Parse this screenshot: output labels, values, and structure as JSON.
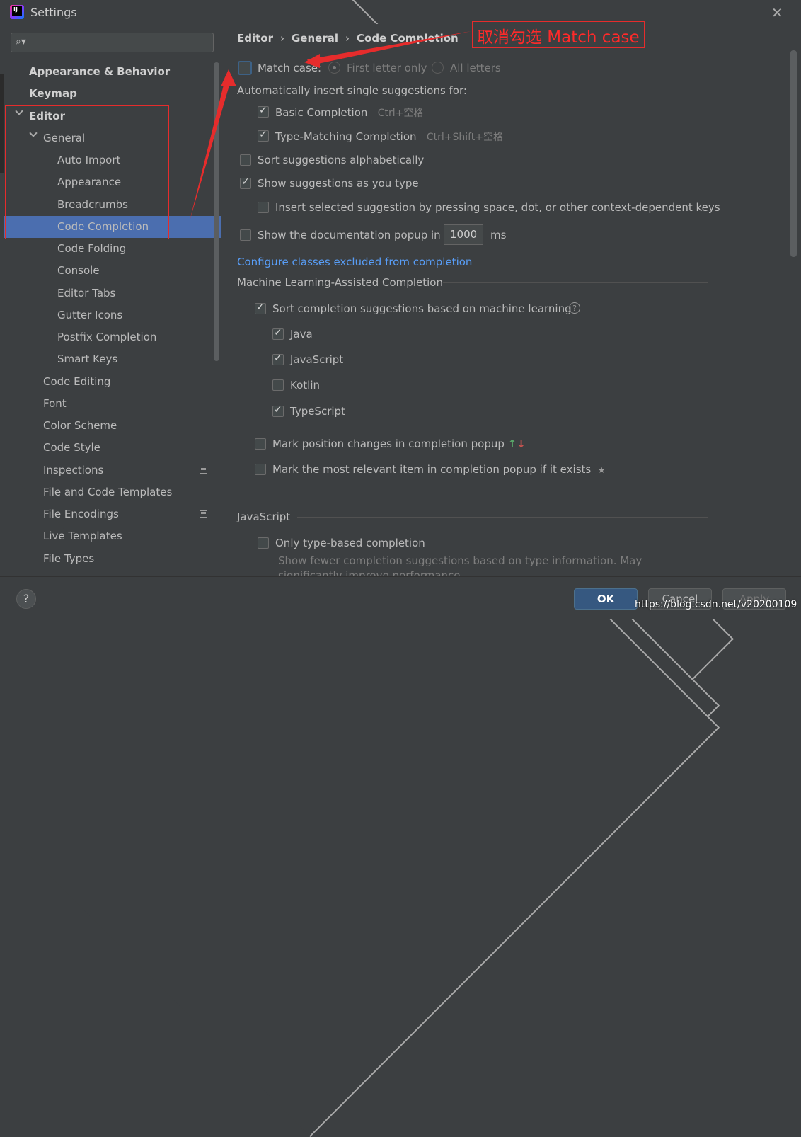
{
  "window": {
    "title": "Settings"
  },
  "tree": [
    {
      "label": "Appearance & Behavior",
      "level": 0,
      "expander": "right",
      "bold": true
    },
    {
      "label": "Keymap",
      "level": 0,
      "expander": "none",
      "bold": true
    },
    {
      "label": "Editor",
      "level": 0,
      "expander": "down",
      "bold": true
    },
    {
      "label": "General",
      "level": 1,
      "expander": "down",
      "bold": false
    },
    {
      "label": "Auto Import",
      "level": 2,
      "expander": "none",
      "bold": false
    },
    {
      "label": "Appearance",
      "level": 2,
      "expander": "none",
      "bold": false
    },
    {
      "label": "Breadcrumbs",
      "level": 2,
      "expander": "none",
      "bold": false
    },
    {
      "label": "Code Completion",
      "level": 2,
      "expander": "none",
      "bold": false,
      "selected": true
    },
    {
      "label": "Code Folding",
      "level": 2,
      "expander": "none",
      "bold": false
    },
    {
      "label": "Console",
      "level": 2,
      "expander": "none",
      "bold": false
    },
    {
      "label": "Editor Tabs",
      "level": 2,
      "expander": "none",
      "bold": false
    },
    {
      "label": "Gutter Icons",
      "level": 2,
      "expander": "none",
      "bold": false
    },
    {
      "label": "Postfix Completion",
      "level": 2,
      "expander": "none",
      "bold": false
    },
    {
      "label": "Smart Keys",
      "level": 2,
      "expander": "right",
      "bold": false
    },
    {
      "label": "Code Editing",
      "level": 1,
      "expander": "none",
      "bold": false
    },
    {
      "label": "Font",
      "level": 1,
      "expander": "none",
      "bold": false
    },
    {
      "label": "Color Scheme",
      "level": 1,
      "expander": "right",
      "bold": false
    },
    {
      "label": "Code Style",
      "level": 1,
      "expander": "right",
      "bold": false
    },
    {
      "label": "Inspections",
      "level": 1,
      "expander": "none",
      "bold": false,
      "project_icon": true
    },
    {
      "label": "File and Code Templates",
      "level": 1,
      "expander": "none",
      "bold": false
    },
    {
      "label": "File Encodings",
      "level": 1,
      "expander": "none",
      "bold": false,
      "project_icon": true
    },
    {
      "label": "Live Templates",
      "level": 1,
      "expander": "none",
      "bold": false
    },
    {
      "label": "File Types",
      "level": 1,
      "expander": "none",
      "bold": false
    }
  ],
  "breadcrumb": {
    "p1": "Editor",
    "p2": "General",
    "p3": "Code Completion"
  },
  "content": {
    "match_case": {
      "label": "Match case:",
      "checked": false,
      "first_letter": "First letter only",
      "all_letters": "All letters"
    },
    "auto_insert_label": "Automatically insert single suggestions for:",
    "basic": {
      "label": "Basic Completion",
      "shortcut": "Ctrl+空格",
      "checked": true
    },
    "type_matching": {
      "label": "Type-Matching Completion",
      "shortcut": "Ctrl+Shift+空格",
      "checked": true
    },
    "sort_alpha": {
      "label": "Sort suggestions alphabetically",
      "checked": false
    },
    "show_as_type": {
      "label": "Show suggestions as you type",
      "checked": true
    },
    "insert_selected": {
      "label": "Insert selected suggestion by pressing space, dot, or other context-dependent keys",
      "checked": false
    },
    "doc_popup": {
      "label": "Show the documentation popup in",
      "value": "1000",
      "unit": "ms",
      "checked": false
    },
    "configure_link": "Configure classes excluded from completion",
    "ml_section": "Machine Learning-Assisted Completion",
    "ml_sort": {
      "label": "Sort completion suggestions based on machine learning",
      "checked": true
    },
    "langs": [
      {
        "label": "Java",
        "checked": true
      },
      {
        "label": "JavaScript",
        "checked": true
      },
      {
        "label": "Kotlin",
        "checked": false
      },
      {
        "label": "TypeScript",
        "checked": true
      }
    ],
    "mark_position": {
      "label": "Mark position changes in completion popup",
      "checked": false,
      "glyph_up": "↑",
      "glyph_down": "↓"
    },
    "mark_relevant": {
      "label": "Mark the most relevant item in completion popup if it exists",
      "checked": false,
      "glyph": "★"
    },
    "js_section": "JavaScript",
    "only_type": {
      "label": "Only type-based completion",
      "checked": false
    },
    "only_type_desc1": "Show fewer completion suggestions based on type information. May",
    "only_type_desc2": "significantly improve performance."
  },
  "annotation": {
    "text": "取消勾选 Match case"
  },
  "footer": {
    "help": "?",
    "ok": "OK",
    "cancel": "Cancel",
    "apply": "Apply",
    "watermark": "https://blog.csdn.net/v20200109"
  },
  "colors": {
    "background": "#3c3f41",
    "selection": "#4b6eaf",
    "link": "#589df6",
    "annotation": "#e62c2c",
    "ok_button": "#365880"
  }
}
